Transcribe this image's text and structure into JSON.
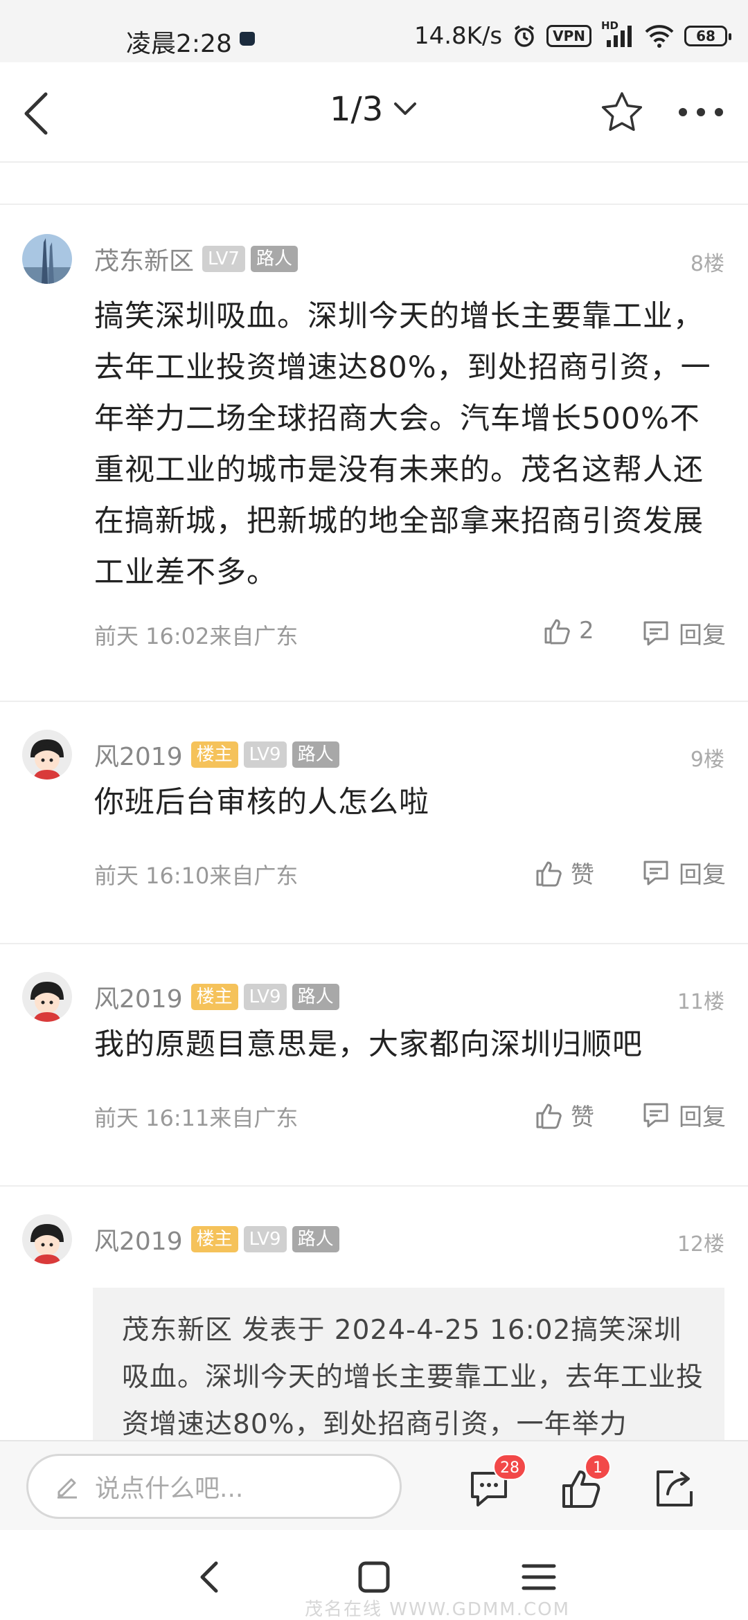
{
  "status_bar": {
    "time": "凌晨2:28",
    "net_speed": "14.8K/s",
    "vpn": "VPN",
    "battery": "68",
    "net_type": "HD"
  },
  "header": {
    "page_indicator": "1/3"
  },
  "posts": [
    {
      "username": "茂东新区",
      "is_owner": false,
      "level": "LV7",
      "title": "路人",
      "floor": "8楼",
      "content": "搞笑深圳吸血。深圳今天的增长主要靠工业，去年工业投资增速达80%，到处招商引资，一年举力二场全球招商大会。汽车增长500%不重视工业的城市是没有未来的。茂名这帮人还在搞新城，把新城的地全部拿来招商引资发展工业差不多。",
      "time": "前天 16:02来自广东",
      "like_label": "2",
      "reply_label": "回复"
    },
    {
      "username": "风2019",
      "owner_label": "楼主",
      "level": "LV9",
      "title": "路人",
      "floor": "9楼",
      "content": "你班后台审核的人怎么啦",
      "time": "前天 16:10来自广东",
      "like_label": "赞",
      "reply_label": "回复"
    },
    {
      "username": "风2019",
      "owner_label": "楼主",
      "level": "LV9",
      "title": "路人",
      "floor": "11楼",
      "content": "我的原题目意思是，大家都向深圳归顺吧",
      "time": "前天 16:11来自广东",
      "like_label": "赞",
      "reply_label": "回复"
    },
    {
      "username": "风2019",
      "owner_label": "楼主",
      "level": "LV9",
      "title": "路人",
      "floor": "12楼",
      "quote": "茂东新区 发表于 2024-4-25 16:02搞笑深圳吸血。深圳今天的增长主要靠工业，去年工业投资增速达80%，到处招商引资，一年举力"
    }
  ],
  "input_bar": {
    "placeholder": "说点什么吧...",
    "comment_count": "28",
    "like_count": "1"
  },
  "watermark": "茂名在线 WWW.GDMM.COM"
}
